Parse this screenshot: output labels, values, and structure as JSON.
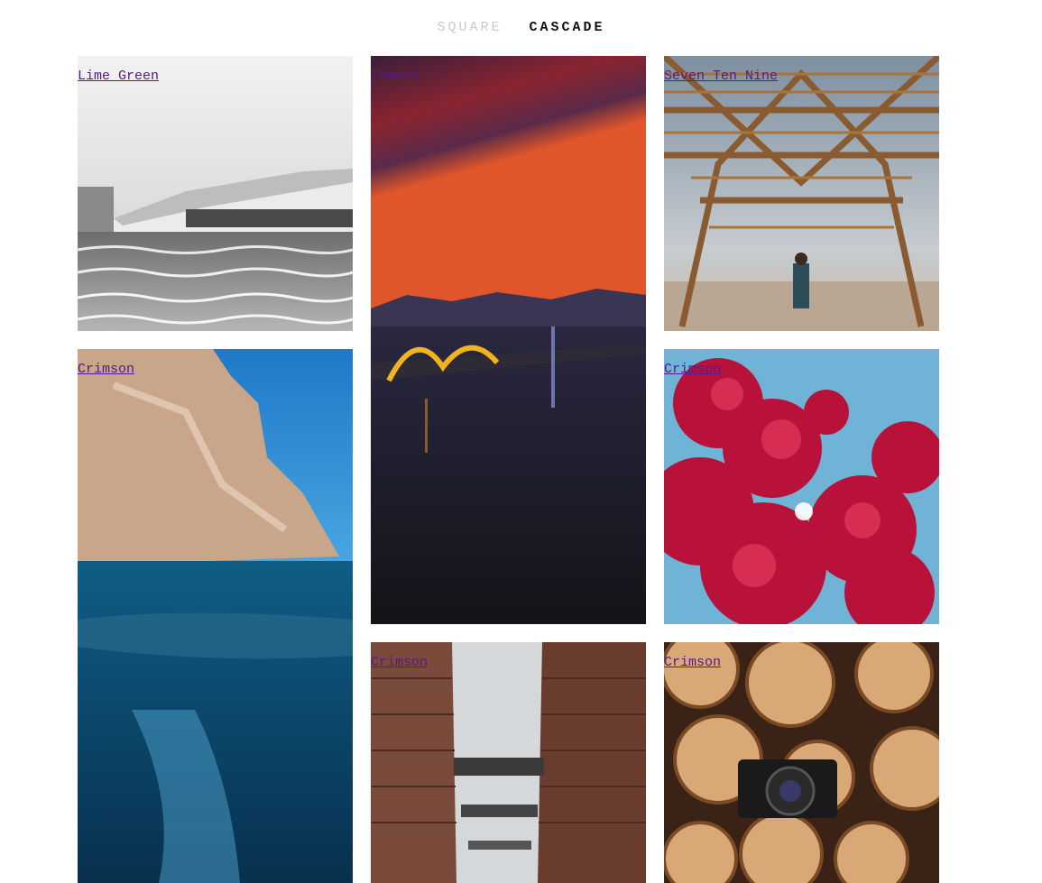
{
  "nav": {
    "options": [
      {
        "label": "SQUARE",
        "active": false
      },
      {
        "label": "CASCADE",
        "active": true
      }
    ]
  },
  "tiles": [
    {
      "label": "Lime Green",
      "image": "black-and-white-modern-building-by-water"
    },
    {
      "label": "Tomato",
      "image": "city-bridge-at-sunset-over-river"
    },
    {
      "label": "Seven Ten Nine",
      "image": "wooden-pyramid-structure-in-desert"
    },
    {
      "label": "Crimson",
      "image": "underwater-cliff-split-view"
    },
    {
      "label": "Crimson",
      "image": "red-blossoms-against-blue-sky"
    },
    {
      "label": "Crimson",
      "image": "brick-warehouse-alley-with-walkways"
    },
    {
      "label": "Crimson",
      "image": "camera-on-stacked-logs"
    }
  ]
}
